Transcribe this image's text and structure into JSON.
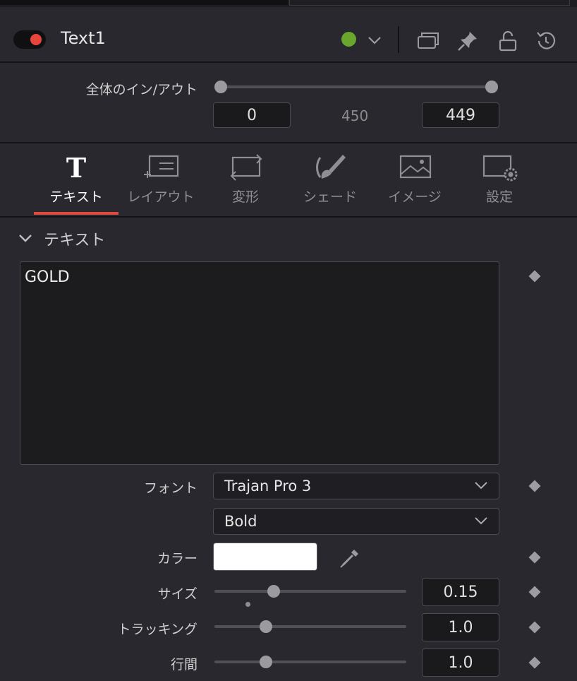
{
  "node": {
    "title": "Text1",
    "status_color": "#6aa62b",
    "toggle_color": "#e8453c"
  },
  "header_icons": [
    "chevron-down-icon",
    "stack-icon",
    "pin-icon",
    "unlock-icon",
    "reset-icon"
  ],
  "inout": {
    "label": "全体のイン/アウト",
    "in_value": "0",
    "duration": "450",
    "out_value": "449",
    "in_position": 0,
    "out_position": 1
  },
  "tabs": [
    {
      "label": "テキスト",
      "icon": "text-t-icon",
      "active": true
    },
    {
      "label": "レイアウト",
      "icon": "layout-icon",
      "active": false
    },
    {
      "label": "変形",
      "icon": "transform-icon",
      "active": false
    },
    {
      "label": "シェード",
      "icon": "brush-icon",
      "active": false
    },
    {
      "label": "イメージ",
      "icon": "image-icon",
      "active": false
    },
    {
      "label": "設定",
      "icon": "settings-icon",
      "active": false
    }
  ],
  "section": {
    "title": "テキスト",
    "styled_text": "GOLD"
  },
  "font": {
    "label": "フォント",
    "family": "Trajan Pro 3",
    "style": "Bold"
  },
  "color": {
    "label": "カラー",
    "value": "#ffffff"
  },
  "size": {
    "label": "サイズ",
    "value": "0.15",
    "slider_fraction": 0.31
  },
  "tracking": {
    "label": "トラッキング",
    "value": "1.0",
    "slider_fraction": 0.27
  },
  "line_spacing": {
    "label": "行間",
    "value": "1.0",
    "slider_fraction": 0.27
  }
}
